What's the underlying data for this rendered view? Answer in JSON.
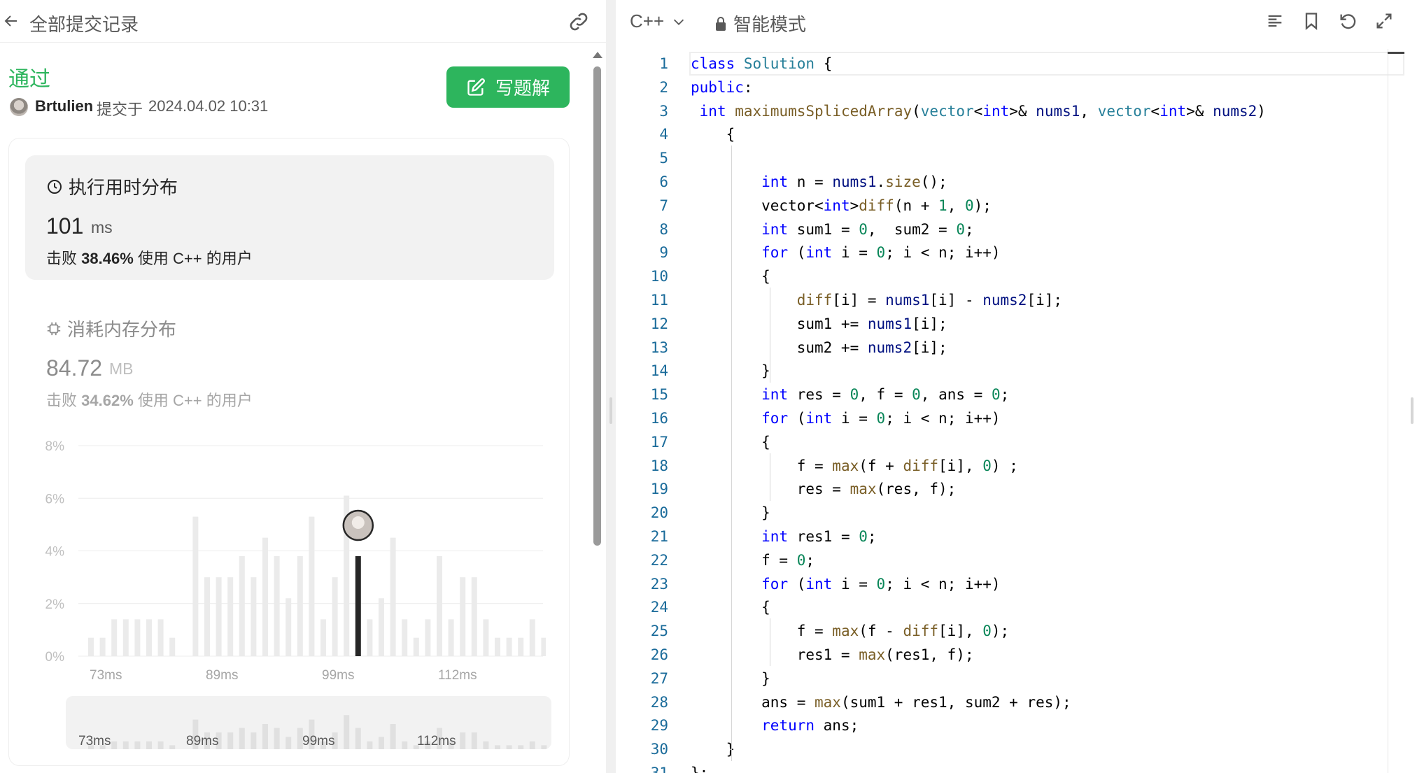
{
  "left_header": {
    "title": "全部提交记录",
    "back_icon": "arrow-left-icon",
    "link_icon": "link-icon"
  },
  "submission": {
    "status": "通过",
    "status_color": "#2db55d",
    "author": "Brtulien",
    "submitted_label": "提交于",
    "time": "2024.04.02 10:31",
    "write_solution_label": "写题解"
  },
  "runtime": {
    "title": "执行用时分布",
    "value": "101",
    "unit": "ms",
    "beat_prefix": "击败",
    "beat_percent": "38.46%",
    "beat_suffix": "使用 C++ 的用户"
  },
  "memory": {
    "title": "消耗内存分布",
    "value": "84.72",
    "unit": "MB",
    "beat_prefix": "击败",
    "beat_percent": "34.62%",
    "beat_suffix": "使用 C++ 的用户"
  },
  "chart_data": {
    "type": "bar",
    "y_ticks": [
      "8%",
      "6%",
      "4%",
      "2%",
      "0%"
    ],
    "x_ticks": [
      "73ms",
      "89ms",
      "99ms",
      "112ms"
    ],
    "ylim": [
      0,
      8
    ],
    "values": [
      0.7,
      0.7,
      1.4,
      1.4,
      1.4,
      1.4,
      1.4,
      0.7,
      0,
      5.3,
      3.0,
      3.0,
      3.0,
      3.8,
      3.0,
      4.5,
      3.8,
      2.2,
      3.8,
      5.3,
      1.4,
      3.0,
      6.1,
      3.8,
      1.4,
      2.2,
      4.5,
      1.4,
      0.7,
      1.4,
      3.8,
      1.4,
      3.0,
      3.0,
      1.4,
      0.7,
      0.7,
      0.7,
      1.4,
      0.7,
      0.7,
      0.7
    ],
    "highlight_index": 23,
    "highlight_color": "#262626",
    "bar_color": "#ebebeb"
  },
  "mini_chart": {
    "labels": [
      "73ms",
      "89ms",
      "99ms",
      "112ms"
    ]
  },
  "editor": {
    "language": "C++",
    "mode": "智能模式",
    "toolbar_icons": [
      "format-icon",
      "bookmark-icon",
      "reset-icon",
      "expand-icon"
    ]
  },
  "code": [
    [
      [
        "kw",
        "class"
      ],
      [
        "",
        " "
      ],
      [
        "ty",
        "Solution"
      ],
      [
        "",
        " {"
      ]
    ],
    [
      [
        "kw",
        "public"
      ],
      [
        "",
        ":"
      ]
    ],
    [
      [
        "",
        " "
      ],
      [
        "kw",
        "int"
      ],
      [
        "",
        " "
      ],
      [
        "fn",
        "maximumsSplicedArray"
      ],
      [
        "",
        "("
      ],
      [
        "ty",
        "vector"
      ],
      [
        "",
        "<"
      ],
      [
        "kw",
        "int"
      ],
      [
        "",
        ">& "
      ],
      [
        "vr",
        "nums1"
      ],
      [
        "",
        ", "
      ],
      [
        "ty",
        "vector"
      ],
      [
        "",
        "<"
      ],
      [
        "kw",
        "int"
      ],
      [
        "",
        ">& "
      ],
      [
        "vr",
        "nums2"
      ],
      [
        "",
        ")"
      ]
    ],
    [
      [
        "",
        "    {"
      ]
    ],
    [
      [
        "",
        ""
      ]
    ],
    [
      [
        "",
        "        "
      ],
      [
        "kw",
        "int"
      ],
      [
        "",
        " n = "
      ],
      [
        "vr",
        "nums1"
      ],
      [
        "",
        "."
      ],
      [
        "fn",
        "size"
      ],
      [
        "",
        "();"
      ]
    ],
    [
      [
        "",
        "        vector<"
      ],
      [
        "kw",
        "int"
      ],
      [
        "",
        ">"
      ],
      [
        "fn",
        "diff"
      ],
      [
        "",
        "(n + "
      ],
      [
        "nm",
        "1"
      ],
      [
        "",
        ", "
      ],
      [
        "nm",
        "0"
      ],
      [
        "",
        ");"
      ]
    ],
    [
      [
        "",
        "        "
      ],
      [
        "kw",
        "int"
      ],
      [
        "",
        " sum1 = "
      ],
      [
        "nm",
        "0"
      ],
      [
        "",
        ",  sum2 = "
      ],
      [
        "nm",
        "0"
      ],
      [
        "",
        ";"
      ]
    ],
    [
      [
        "",
        "        "
      ],
      [
        "kw",
        "for"
      ],
      [
        "",
        " ("
      ],
      [
        "kw",
        "int"
      ],
      [
        "",
        " i = "
      ],
      [
        "nm",
        "0"
      ],
      [
        "",
        "; i < n; i++)"
      ]
    ],
    [
      [
        "",
        "        {"
      ]
    ],
    [
      [
        "",
        "            "
      ],
      [
        "fn",
        "diff"
      ],
      [
        "",
        "[i] = "
      ],
      [
        "vr",
        "nums1"
      ],
      [
        "",
        "[i] - "
      ],
      [
        "vr",
        "nums2"
      ],
      [
        "",
        "[i];"
      ]
    ],
    [
      [
        "",
        "            sum1 += "
      ],
      [
        "vr",
        "nums1"
      ],
      [
        "",
        "[i];"
      ]
    ],
    [
      [
        "",
        "            sum2 += "
      ],
      [
        "vr",
        "nums2"
      ],
      [
        "",
        "[i];"
      ]
    ],
    [
      [
        "",
        "        }"
      ]
    ],
    [
      [
        "",
        "        "
      ],
      [
        "kw",
        "int"
      ],
      [
        "",
        " res = "
      ],
      [
        "nm",
        "0"
      ],
      [
        "",
        ", f = "
      ],
      [
        "nm",
        "0"
      ],
      [
        "",
        ", ans = "
      ],
      [
        "nm",
        "0"
      ],
      [
        "",
        ";"
      ]
    ],
    [
      [
        "",
        "        "
      ],
      [
        "kw",
        "for"
      ],
      [
        "",
        " ("
      ],
      [
        "kw",
        "int"
      ],
      [
        "",
        " i = "
      ],
      [
        "nm",
        "0"
      ],
      [
        "",
        "; i < n; i++)"
      ]
    ],
    [
      [
        "",
        "        {"
      ]
    ],
    [
      [
        "",
        "            f = "
      ],
      [
        "fn",
        "max"
      ],
      [
        "",
        "(f + "
      ],
      [
        "fn",
        "diff"
      ],
      [
        "",
        "[i], "
      ],
      [
        "nm",
        "0"
      ],
      [
        "",
        ") ;"
      ]
    ],
    [
      [
        "",
        "            res = "
      ],
      [
        "fn",
        "max"
      ],
      [
        "",
        "(res, f);"
      ]
    ],
    [
      [
        "",
        "        }"
      ]
    ],
    [
      [
        "",
        "        "
      ],
      [
        "kw",
        "int"
      ],
      [
        "",
        " res1 = "
      ],
      [
        "nm",
        "0"
      ],
      [
        "",
        ";"
      ]
    ],
    [
      [
        "",
        "        f = "
      ],
      [
        "nm",
        "0"
      ],
      [
        "",
        ";"
      ]
    ],
    [
      [
        "",
        "        "
      ],
      [
        "kw",
        "for"
      ],
      [
        "",
        " ("
      ],
      [
        "kw",
        "int"
      ],
      [
        "",
        " i = "
      ],
      [
        "nm",
        "0"
      ],
      [
        "",
        "; i < n; i++)"
      ]
    ],
    [
      [
        "",
        "        {"
      ]
    ],
    [
      [
        "",
        "            f = "
      ],
      [
        "fn",
        "max"
      ],
      [
        "",
        "(f - "
      ],
      [
        "fn",
        "diff"
      ],
      [
        "",
        "[i], "
      ],
      [
        "nm",
        "0"
      ],
      [
        "",
        ");"
      ]
    ],
    [
      [
        "",
        "            res1 = "
      ],
      [
        "fn",
        "max"
      ],
      [
        "",
        "(res1, f);"
      ]
    ],
    [
      [
        "",
        "        }"
      ]
    ],
    [
      [
        "",
        "        ans = "
      ],
      [
        "fn",
        "max"
      ],
      [
        "",
        "(sum1 + res1, sum2 + res);"
      ]
    ],
    [
      [
        "",
        "        "
      ],
      [
        "kw",
        "return"
      ],
      [
        "",
        " ans;"
      ]
    ],
    [
      [
        "",
        "    }"
      ]
    ],
    [
      [
        "",
        "};"
      ]
    ]
  ]
}
